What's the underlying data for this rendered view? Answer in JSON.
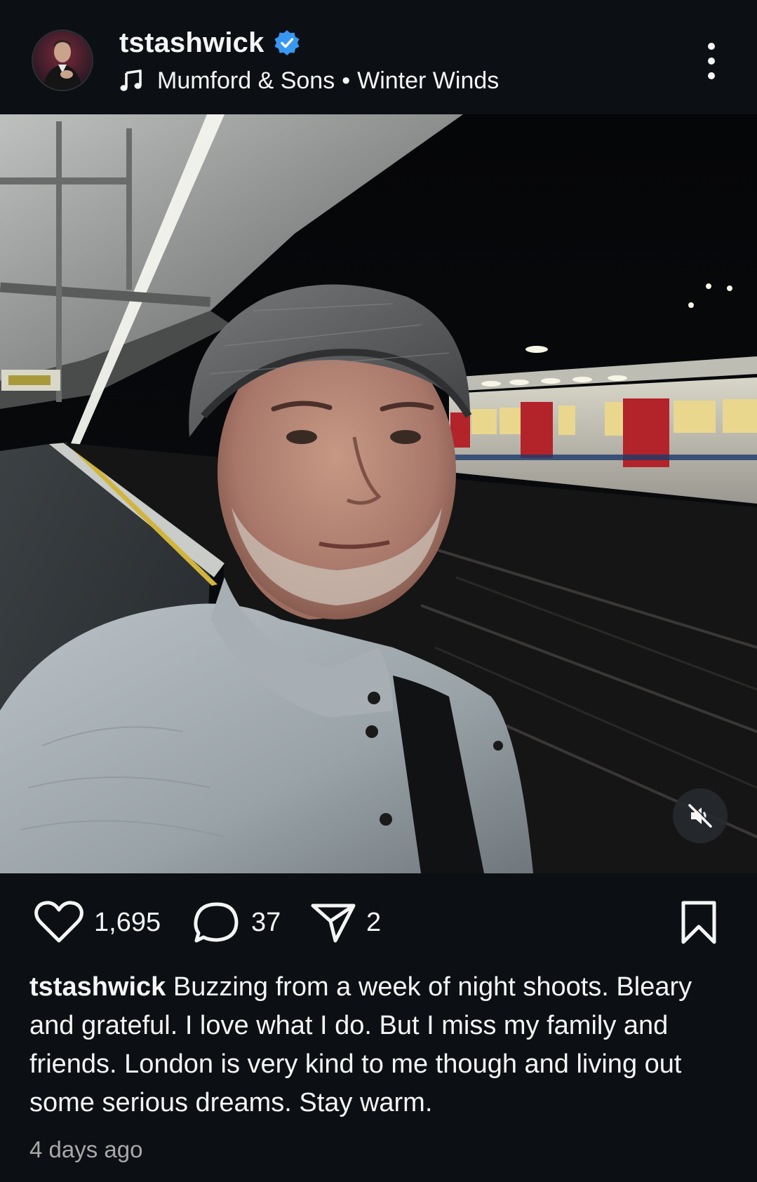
{
  "post": {
    "username": "tstashwick",
    "verified": true,
    "music": {
      "artist": "Mumford & Sons",
      "separator": "•",
      "song": "Winter Winds"
    },
    "more_icon": "more-vertical-icon",
    "mute_icon": "speaker-muted-icon",
    "actions": {
      "likes": "1,695",
      "comments": "37",
      "shares": "2",
      "like_icon": "heart-icon",
      "comment_icon": "comment-bubble-icon",
      "share_icon": "paper-plane-icon",
      "save_icon": "bookmark-icon"
    },
    "caption": {
      "username": "tstashwick",
      "text": "Buzzing from a week of night shoots. Bleary and grateful. I love what I do. But I miss my family and friends. London is very kind to me though and living out some serious dreams. Stay warm."
    },
    "timestamp": "4 days ago"
  },
  "colors": {
    "background": "#0c1014",
    "verified_badge": "#3897f0",
    "text_primary": "#f5f5f5",
    "text_secondary": "#a8a8a8"
  }
}
